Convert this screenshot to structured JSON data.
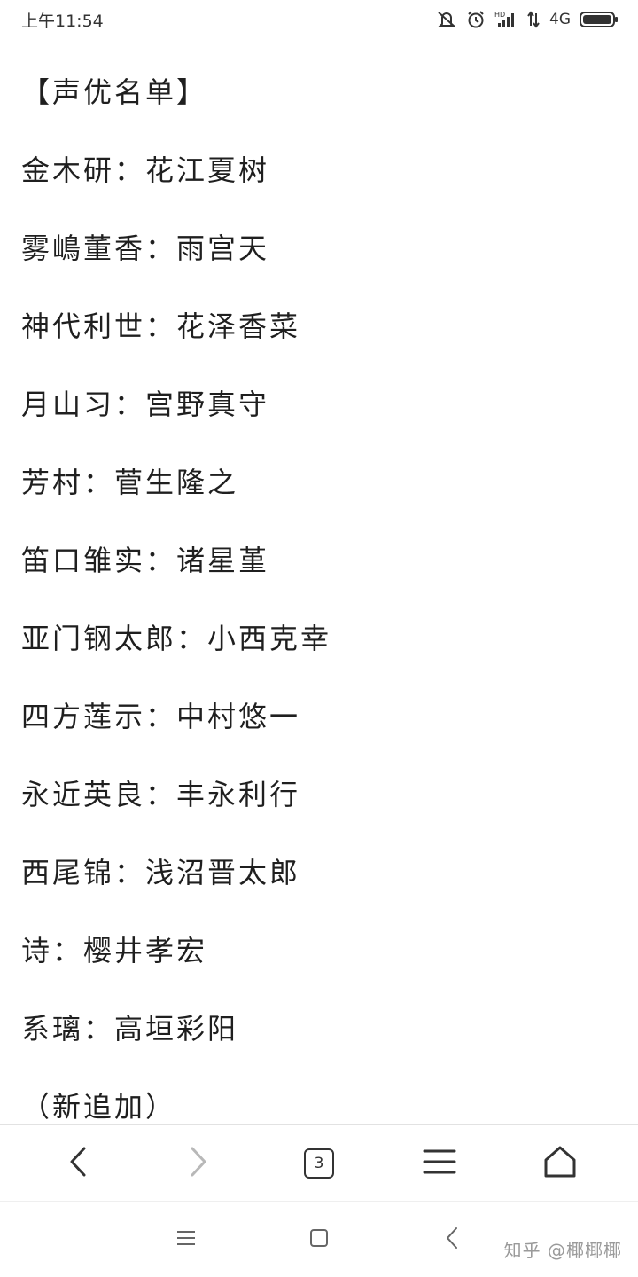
{
  "status_bar": {
    "time": "上午11:54",
    "network": "4G",
    "icons": [
      "mute-vibrate-icon",
      "alarm-icon",
      "hd-signal-icon",
      "data-arrows-icon",
      "battery-icon"
    ]
  },
  "article": {
    "lines": [
      "【声优名单】",
      "金木研：花江夏树",
      "雾嶋董香：雨宫天",
      "神代利世：花泽香菜",
      "月山习：宫野真守",
      "芳村：菅生隆之",
      "笛口雏实：诸星堇",
      "亚门钢太郎：小西克幸",
      "四方莲示：中村悠一",
      "永近英良：丰永利行",
      "西尾锦：浅沼晋太郎",
      "诗：樱井孝宏",
      "系璃：高垣彩阳",
      "（新追加）"
    ]
  },
  "browser_toolbar": {
    "tab_count": "3",
    "icons": [
      "back-icon",
      "forward-icon",
      "tabs-icon",
      "menu-icon",
      "home-icon"
    ]
  },
  "system_nav": {
    "icons": [
      "recent-apps-icon",
      "home-square-icon",
      "system-back-icon"
    ]
  },
  "watermark": "知乎 @椰椰椰"
}
